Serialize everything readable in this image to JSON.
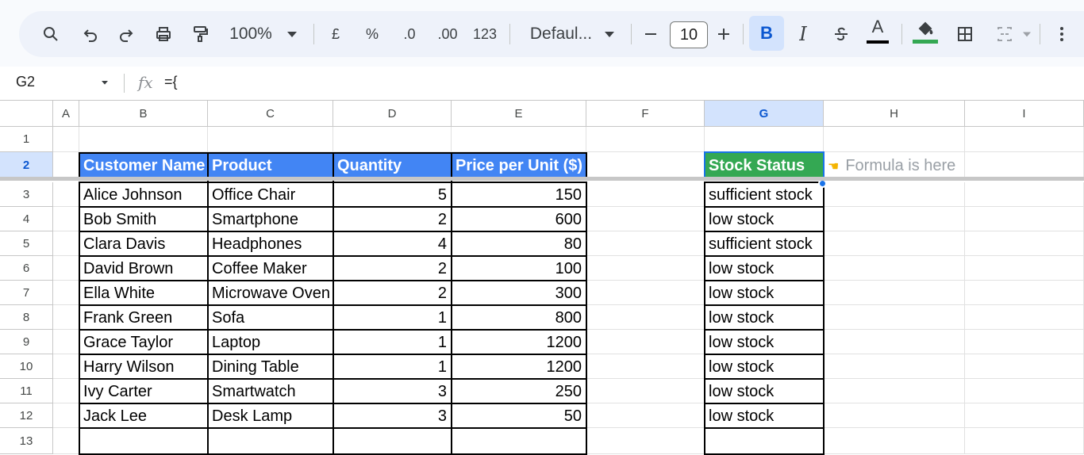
{
  "toolbar": {
    "zoom": "100%",
    "currency": "£",
    "percent": "%",
    "dec_decrease": ".0",
    "dec_increase": ".00",
    "number_format": "123",
    "font": "Defaul...",
    "font_size": "10",
    "bold": "B",
    "italic": "I",
    "text_color_label": "A",
    "text_color": "#000000",
    "fill_color": "#34a853"
  },
  "formula_bar": {
    "cell_ref": "G2",
    "formula": "={"
  },
  "columns": [
    "A",
    "B",
    "C",
    "D",
    "E",
    "F",
    "G",
    "H",
    "I"
  ],
  "selected_column": "G",
  "rows": [
    "1",
    "2",
    "3",
    "4",
    "5",
    "6",
    "7",
    "8",
    "9",
    "10",
    "11",
    "12",
    "13"
  ],
  "selected_row": "2",
  "table": {
    "headers": [
      "Customer Name",
      "Product",
      "Quantity",
      "Price per Unit ($)"
    ],
    "status_header": "Stock Status",
    "note": "Formula is here",
    "rows": [
      {
        "name": "Alice Johnson",
        "product": "Office Chair",
        "qty": "5",
        "price": "150",
        "status": "sufficient stock"
      },
      {
        "name": "Bob Smith",
        "product": "Smartphone",
        "qty": "2",
        "price": "600",
        "status": "low stock"
      },
      {
        "name": "Clara Davis",
        "product": "Headphones",
        "qty": "4",
        "price": "80",
        "status": "sufficient stock"
      },
      {
        "name": "David Brown",
        "product": "Coffee Maker",
        "qty": "2",
        "price": "100",
        "status": "low stock"
      },
      {
        "name": "Ella White",
        "product": "Microwave Oven",
        "qty": "2",
        "price": "300",
        "status": "low stock"
      },
      {
        "name": "Frank Green",
        "product": "Sofa",
        "qty": "1",
        "price": "800",
        "status": "low stock"
      },
      {
        "name": "Grace Taylor",
        "product": "Laptop",
        "qty": "1",
        "price": "1200",
        "status": "low stock"
      },
      {
        "name": "Harry Wilson",
        "product": "Dining Table",
        "qty": "1",
        "price": "1200",
        "status": "low stock"
      },
      {
        "name": "Ivy Carter",
        "product": "Smartwatch",
        "qty": "3",
        "price": "250",
        "status": "low stock"
      },
      {
        "name": "Jack Lee",
        "product": "Desk Lamp",
        "qty": "3",
        "price": "50",
        "status": "low stock"
      }
    ]
  }
}
